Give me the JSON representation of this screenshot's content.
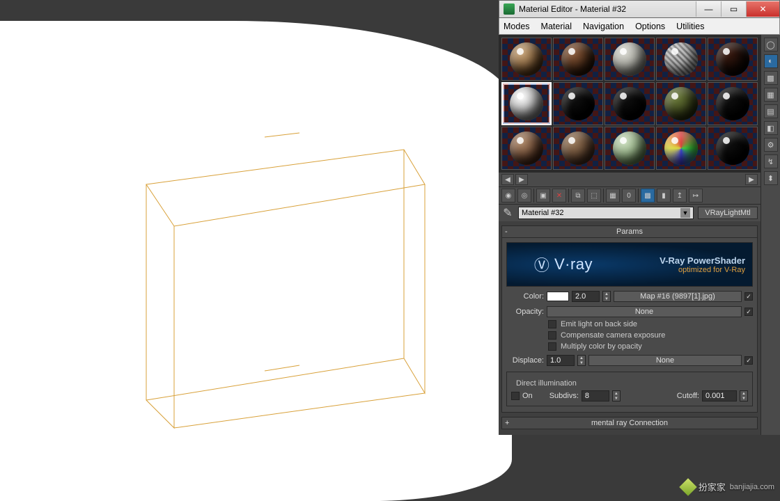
{
  "window": {
    "title": "Material Editor - Material #32"
  },
  "menus": {
    "modes": "Modes",
    "material": "Material",
    "navigation": "Navigation",
    "options": "Options",
    "utilities": "Utilities"
  },
  "samples": [
    {
      "bg": "radial-gradient(circle at 35% 30%, #caa67a, #5a3a1a 70%)"
    },
    {
      "bg": "radial-gradient(circle at 35% 30%, #8b5a3a, #2a1608 70%)"
    },
    {
      "bg": "radial-gradient(circle at 35% 30%, #d8d8d0, #8a8a82 70%)"
    },
    {
      "bg": "repeating-linear-gradient(45deg,#bbb 0 3px,#777 3px 6px)"
    },
    {
      "bg": "radial-gradient(circle at 35% 30%, #3a1a10, #0a0402 70%)"
    },
    {
      "bg": "radial-gradient(circle at 35% 30%, #fff, #888 70%)",
      "sel": true
    },
    {
      "bg": "radial-gradient(circle at 35% 30%, #111, #000 70%)"
    },
    {
      "bg": "radial-gradient(circle at 35% 30%, #111, #000 70%)"
    },
    {
      "bg": "radial-gradient(circle at 35% 30%, #6a7a3a, #2a3010 70%)"
    },
    {
      "bg": "radial-gradient(circle at 35% 30%, #111, #000 70%)"
    },
    {
      "bg": "radial-gradient(circle at 35% 30%, #b08a6a, #4a2a1a 70%)"
    },
    {
      "bg": "radial-gradient(circle at 35% 30%, #9a7a5a, #4a3020 70%)"
    },
    {
      "bg": "radial-gradient(circle at 35% 30%, #cde0c0, #6a8a5a 70%)"
    },
    {
      "bg": "conic-gradient(#e04040,#40e040,#4040e0,#e0e040,#e04040)"
    },
    {
      "bg": "radial-gradient(circle at 35% 30%, #111, #000 70%)"
    }
  ],
  "material": {
    "name": "Material #32",
    "type": "VRayLightMtl"
  },
  "rollouts": {
    "params": "Params",
    "mentalray": "mental ray Connection"
  },
  "vray": {
    "brand": "V·ray",
    "line1": "V-Ray PowerShader",
    "line2": "optimized for V-Ray"
  },
  "params": {
    "color_label": "Color:",
    "multiplier": "2.0",
    "map": "Map #16 (9897[1].jpg)",
    "map_enabled": true,
    "opacity_label": "Opacity:",
    "opacity_map": "None",
    "opacity_enabled": true,
    "emit_back": "Emit light on back side",
    "compensate": "Compensate camera exposure",
    "multiply": "Multiply color by opacity",
    "displace_label": "Displace:",
    "displace_value": "1.0",
    "displace_map": "None",
    "displace_enabled": true,
    "direct_illum": "Direct illumination",
    "on_label": "On",
    "subdivs_label": "Subdivs:",
    "subdivs": "8",
    "cutoff_label": "Cutoff:",
    "cutoff": "0.001"
  },
  "watermark": {
    "text": "扮家家",
    "url": "banjiajia.com"
  }
}
